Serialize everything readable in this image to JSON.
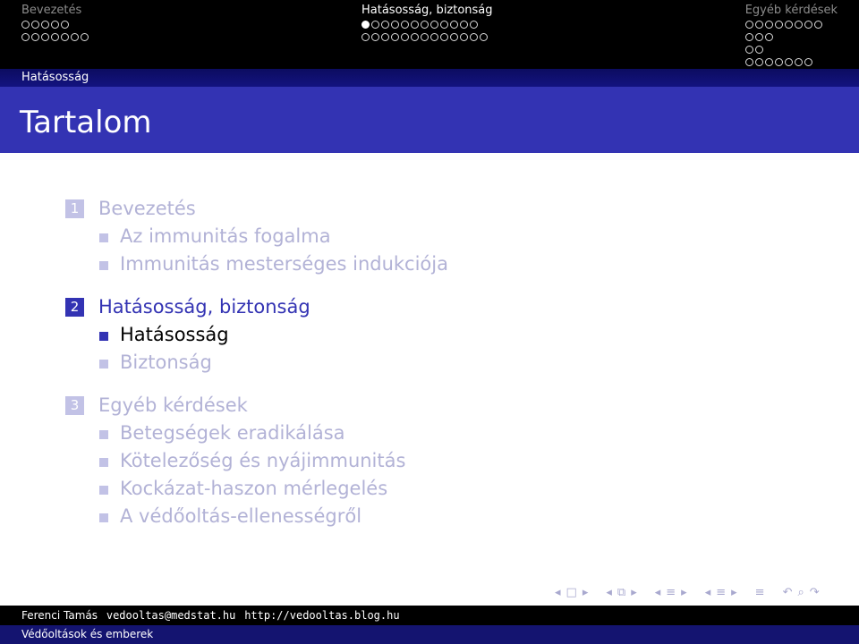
{
  "header": {
    "sections": [
      {
        "title": "Bevezetés",
        "current": false,
        "dot_rows": [
          [
            0,
            0,
            0,
            0,
            0
          ],
          [
            0,
            0,
            0,
            0,
            0,
            0,
            0
          ]
        ]
      },
      {
        "title": "Hatásosság, biztonság",
        "current": true,
        "dot_rows": [
          [
            1,
            0,
            0,
            0,
            0,
            0,
            0,
            0,
            0,
            0,
            0,
            0
          ],
          [
            0,
            0,
            0,
            0,
            0,
            0,
            0,
            0,
            0,
            0,
            0,
            0,
            0
          ]
        ]
      },
      {
        "title": "Egyéb kérdések",
        "current": false,
        "dot_rows": [
          [
            0,
            0,
            0,
            0,
            0,
            0,
            0,
            0
          ],
          [
            0,
            0,
            0
          ],
          [
            0,
            0
          ],
          [
            0,
            0,
            0,
            0,
            0,
            0,
            0
          ]
        ]
      }
    ]
  },
  "subsection_bar": "Hatásosság",
  "frame_title": "Tartalom",
  "toc": [
    {
      "number": "1",
      "title": "Bevezetés",
      "active": false,
      "subsections": [
        {
          "title": "Az immunitás fogalma",
          "active": false
        },
        {
          "title": "Immunitás mesterséges indukciója",
          "active": false
        }
      ]
    },
    {
      "number": "2",
      "title": "Hatásosság, biztonság",
      "active": true,
      "subsections": [
        {
          "title": "Hatásosság",
          "active": true
        },
        {
          "title": "Biztonság",
          "active": false
        }
      ]
    },
    {
      "number": "3",
      "title": "Egyéb kérdések",
      "active": false,
      "subsections": [
        {
          "title": "Betegségek eradikálása",
          "active": false
        },
        {
          "title": "Kötelezőség és nyájimmunitás",
          "active": false
        },
        {
          "title": "Kockázat-haszon mérlegelés",
          "active": false
        },
        {
          "title": "A védőoltás-ellenességről",
          "active": false
        }
      ]
    }
  ],
  "nav_symbols": {
    "prev": "◂",
    "next": "▸",
    "slide": "□",
    "frame": "⧉",
    "subsection": "≡",
    "section": "≡",
    "toc": "≡",
    "back": "↶",
    "search": "⌕",
    "forward": "↷"
  },
  "footer": {
    "author": "Ferenci Tamás",
    "email": "vedooltas@medstat.hu",
    "url": "http://vedooltas.blog.hu",
    "talk_title": "Védőoltások és emberek"
  }
}
